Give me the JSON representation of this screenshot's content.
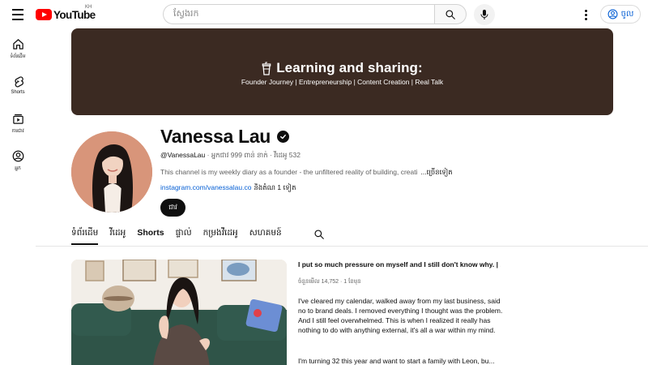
{
  "header": {
    "logo_text": "YouTube",
    "region": "KH",
    "search_placeholder": "ស្វែងរក",
    "signin_label": "ចូល"
  },
  "sidenav": {
    "items": [
      {
        "label": "ទំព័រដើម",
        "icon": "home-icon"
      },
      {
        "label": "Shorts",
        "icon": "shorts-icon"
      },
      {
        "label": "ការជាវ",
        "icon": "subscriptions-icon"
      },
      {
        "label": "អ្នក",
        "icon": "you-icon"
      }
    ]
  },
  "banner": {
    "title": "Learning and sharing:",
    "subtitle": "Founder Journey | Entrepreneurship | Content Creation | Real Talk",
    "bg_color": "#3b2a22"
  },
  "channel": {
    "name": "Vanessa Lau",
    "handle": "@VanessaLau",
    "meta_rest": " · អ្នកជាវ 999 ពាន់ នាក់ · វីដេអូ 532",
    "description": "This channel is my weekly diary as a founder - the unfiltered reality of building, creati",
    "more_label": "...ច្រើនទៀត",
    "link_url": "instagram.com/vanessalau.co",
    "link_others": "និងតំណ 1 ទៀត",
    "subscribe_label": "ជាវ"
  },
  "tabs": [
    {
      "label": "ទំព័រដើម",
      "active": true
    },
    {
      "label": "វីដេអូ",
      "active": false
    },
    {
      "label": "Shorts",
      "active": false
    },
    {
      "label": "ផ្ទាល់",
      "active": false
    },
    {
      "label": "កម្រងវីដេអូ",
      "active": false
    },
    {
      "label": "សហគមន៍",
      "active": false
    }
  ],
  "featured_video": {
    "title": "I put so much pressure on myself and I still don't know why. | ...",
    "meta": "ចំនួនមើល 14,752 · 1 ខែមុន",
    "description": "I've cleared my calendar, walked away from my last business, said no to brand deals. I removed everything I thought was the problem. And I still feel overwhelmed. This is when I realized it really has nothing to do with anything external, it's all a war within my mind.",
    "description2": "I'm turning 32 this year and want to start a family with Leon, bu..."
  }
}
